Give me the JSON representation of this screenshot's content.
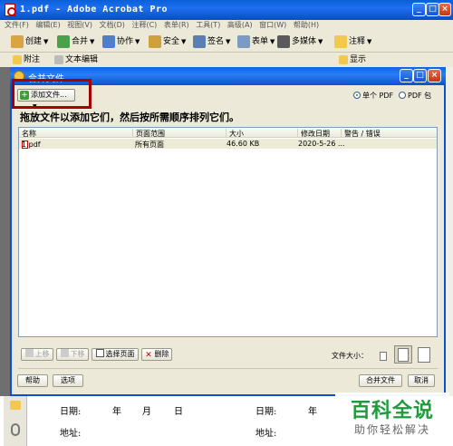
{
  "app": {
    "title": "1.pdf - Adobe Acrobat Pro",
    "menu": [
      "文件(F)",
      "编辑(E)",
      "视图(V)",
      "文档(D)",
      "注释(C)",
      "表单(R)",
      "工具(T)",
      "高级(A)",
      "窗口(W)",
      "帮助(H)"
    ],
    "toolbar1": [
      "创建",
      "合并",
      "协作",
      "安全",
      "签名",
      "表单",
      "多媒体",
      "注释"
    ],
    "toolbar2": [
      "附注",
      "文本编辑",
      "显示"
    ]
  },
  "dialog": {
    "title": "合并文件",
    "add_files": "添加文件...",
    "radio_single": "单个 PDF",
    "radio_package": "PDF 包",
    "instruction": "拖放文件以添加它们，然后按所需顺序排列它们。",
    "columns": [
      "名称",
      "页面范围",
      "大小",
      "修改日期",
      "警告 / 错误"
    ],
    "rows": [
      {
        "name": "1.pdf",
        "range": "所有页面",
        "size": "46.60 KB",
        "date": "2020-5-26 ...",
        "warning": ""
      }
    ],
    "move_up": "上移",
    "move_down": "下移",
    "choose_pages": "选择页面",
    "delete": "删除",
    "file_size_label": "文件大小：",
    "help": "帮助",
    "options": "选项",
    "combine": "合并文件",
    "cancel": "取消"
  },
  "document": {
    "date_label": "日期:",
    "year": "年",
    "month": "月",
    "day": "日",
    "address_label": "地址:"
  },
  "watermark": {
    "title": "百科全说",
    "subtitle": "助你轻松解决"
  },
  "colors": {
    "accent_red": "#a40000",
    "titlebar_blue": "#0e64e8",
    "watermark_green": "#1e9c3c"
  }
}
